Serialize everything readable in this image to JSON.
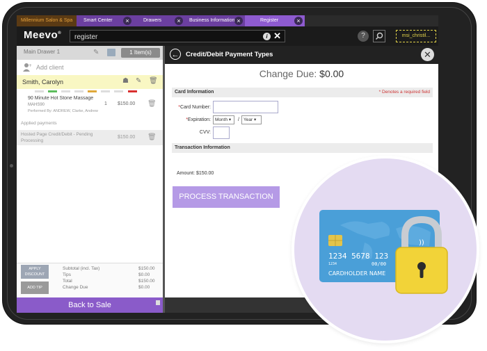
{
  "tabs": {
    "salon": "Millennium Salon & Spa",
    "items": [
      "Smart Center",
      "Drawers",
      "Business Information",
      "Register"
    ]
  },
  "header": {
    "logo": "Meevo",
    "search_value": "register",
    "user": "msi_christil..."
  },
  "left": {
    "drawer": "Main Drawer 1",
    "items_count": "1 Item(s)",
    "add_client": "Add client",
    "client": "Smith, Carolyn",
    "service": {
      "name": "90 Minute Hot Stone Massage",
      "code": "MAHS90",
      "performed_by": "Performed By: ANDREW, Clarke, Andrew",
      "qty": "1",
      "price": "$150.00"
    },
    "applied_label": "Applied payments",
    "payment": {
      "name": "Hosted Page Credit/Debit - Pending Processing",
      "amount": "$150.00"
    },
    "apply_discount": "APPLY DISCOUNT",
    "add_tip": "ADD TIP",
    "totals": {
      "subtotal_label": "Subtotal (incl. Tax)",
      "subtotal": "$150.00",
      "tips_label": "Tips",
      "tips": "$0.00",
      "total_label": "Total",
      "total": "$150.00",
      "change_label": "Change Due",
      "change": "$0.00"
    },
    "back": "Back to Sale"
  },
  "right": {
    "title": "Credit/Debit Payment Types",
    "change_due_label": "Change Due:",
    "change_due_value": "$0.00",
    "card_info": "Card Information",
    "required_note": "* Denotes a required field",
    "card_number_label": "Card Number:",
    "expiration_label": "Expiration:",
    "month": "Month",
    "year": "Year",
    "slash": "/",
    "cvv_label": "CVV:",
    "txn_info": "Transaction Information",
    "amount": "Amount: $150.00",
    "process": "PROCESS TRANSACTION"
  },
  "card": {
    "number": "1234 5678 123",
    "small": "1234",
    "expiry": "00/00",
    "holder": "CARDHOLDER NAME"
  },
  "colors": {
    "purple": "#8a5bc9",
    "process": "#b59ae6",
    "card_blue": "#4a9fd8",
    "lock_yellow": "#f2d338"
  }
}
